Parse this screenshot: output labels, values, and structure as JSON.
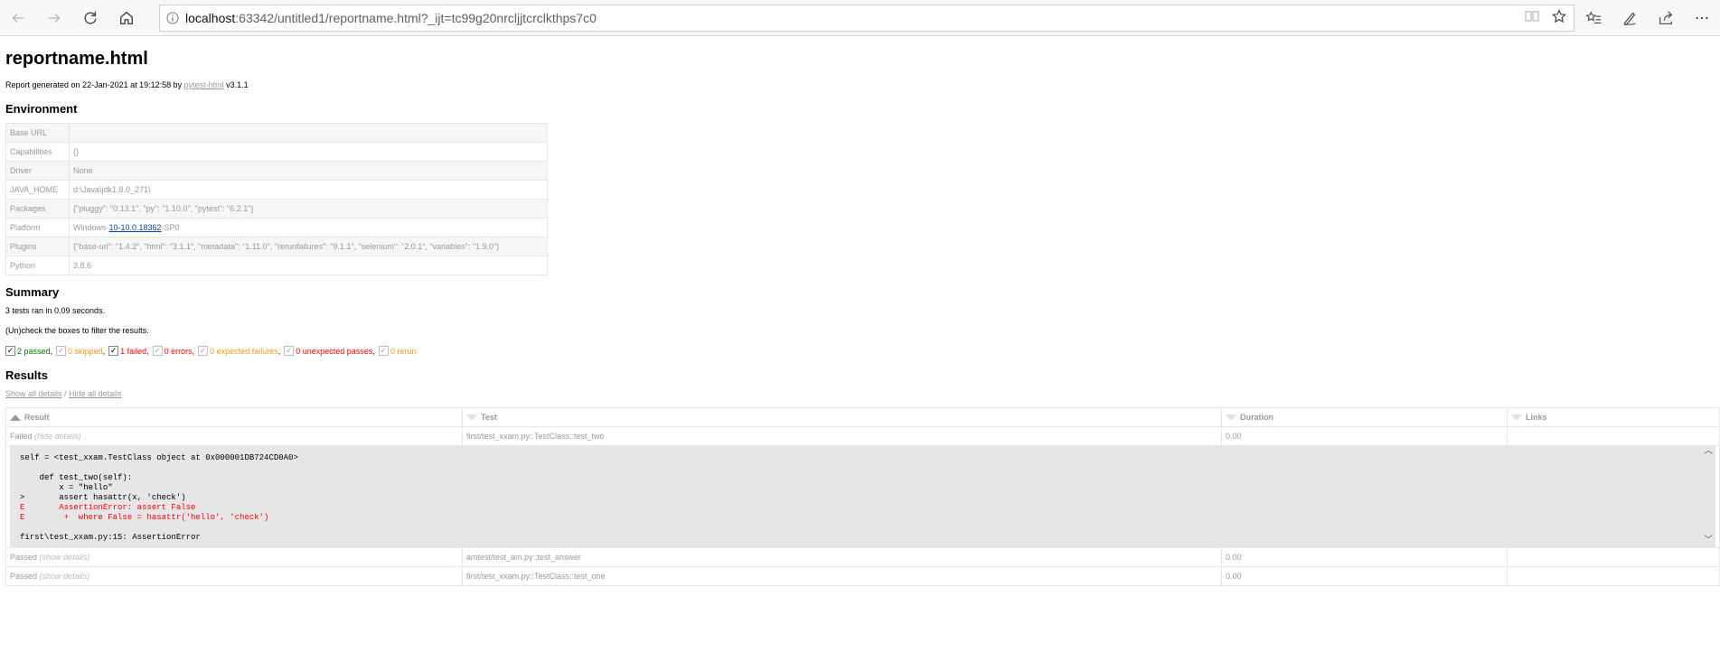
{
  "browser": {
    "url_host": "localhost",
    "url_rest": ":63342/untitled1/reportname.html?_ijt=tc99g20nrcljjtcrclkthps7c0"
  },
  "report": {
    "title": "reportname.html",
    "generated_prefix": "Report generated on 22-Jan-2021 at 19:12:58 by ",
    "generated_link": "pytest-html",
    "generated_suffix": " v3.1.1"
  },
  "environment": {
    "heading": "Environment",
    "rows": [
      {
        "key": "Base URL",
        "value": ""
      },
      {
        "key": "Capabilities",
        "value": "{}"
      },
      {
        "key": "Driver",
        "value": "None"
      },
      {
        "key": "JAVA_HOME",
        "value": "d:\\Java\\jdk1.8.0_271\\"
      },
      {
        "key": "Packages",
        "value": "{\"pluggy\": \"0.13.1\", \"py\": \"1.10.0\", \"pytest\": \"6.2.1\"}"
      },
      {
        "key": "Platform",
        "value_prefix": "Windows-",
        "value_link": "10-10.0.18362",
        "value_suffix": "-SP0"
      },
      {
        "key": "Plugins",
        "value": "{\"base-url\": \"1.4.2\", \"html\": \"3.1.1\", \"metadata\": \"1.11.0\", \"rerunfailures\": \"9.1.1\", \"selenium\": \"2.0.1\", \"variables\": \"1.9.0\"}"
      },
      {
        "key": "Python",
        "value": "3.8.6"
      }
    ]
  },
  "summary": {
    "heading": "Summary",
    "ran_text": "3 tests ran in 0.09 seconds.",
    "filter_hint": "(Un)check the boxes to filter the results.",
    "filters": {
      "passed": "2 passed",
      "skipped": "0 skipped",
      "failed": "1 failed",
      "errors": "0 errors",
      "xfail": "0 expected failures",
      "xpass": "0 unexpected passes",
      "rerun": "0 rerun"
    }
  },
  "results": {
    "heading": "Results",
    "show_all": "Show all details",
    "slash": " / ",
    "hide_all": "Hide all details",
    "columns": {
      "result": "Result",
      "test": "Test",
      "duration": "Duration",
      "links": "Links"
    },
    "rows": [
      {
        "result": "Failed",
        "detail": "(hide details)",
        "test": "first/test_xxam.py::TestClass::test_two",
        "duration": "0.00"
      },
      {
        "result": "Passed",
        "detail": "(show details)",
        "test": "amtest/test_am.py::test_answer",
        "duration": "0.00"
      },
      {
        "result": "Passed",
        "detail": "(show details)",
        "test": "first/test_xxam.py::TestClass::test_one",
        "duration": "0.00"
      }
    ],
    "log": {
      "l1": "self = <test_xxam.TestClass object at 0x000001DB724CD0A0>",
      "l2": "    def test_two(self):",
      "l3": "        x = \"hello\"",
      "l4": ">       assert hasattr(x, 'check')",
      "l5": "E       AssertionError: assert False",
      "l6": "E        +  where False = hasattr('hello', 'check')",
      "l7": "first\\test_xxam.py:15: AssertionError"
    }
  }
}
